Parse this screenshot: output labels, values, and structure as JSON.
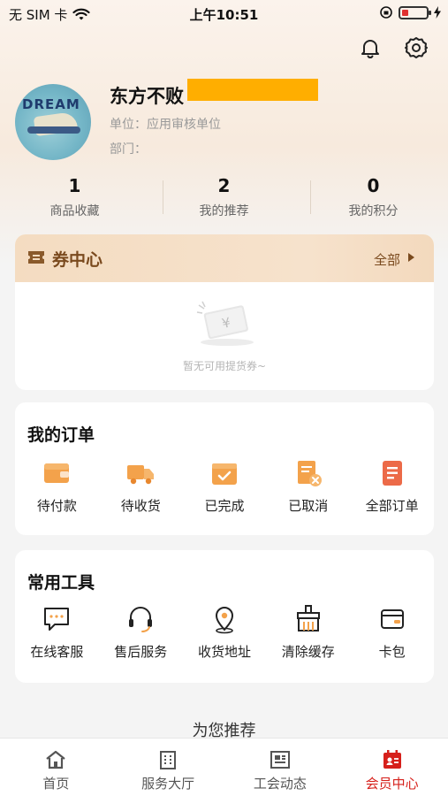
{
  "status_bar": {
    "carrier": "无 SIM 卡",
    "time": "上午10:51"
  },
  "profile": {
    "avatar_text": "DREAM",
    "name": "东方不败",
    "unit": "单位：应用审核单位",
    "dept": "部门："
  },
  "stats": [
    {
      "value": "1",
      "label": "商品收藏"
    },
    {
      "value": "2",
      "label": "我的推荐"
    },
    {
      "value": "0",
      "label": "我的积分"
    }
  ],
  "coupon": {
    "title": "券中心",
    "all": "全部",
    "empty_text": "暂无可用提货券~"
  },
  "orders": {
    "title": "我的订单",
    "items": [
      {
        "label": "待付款",
        "icon": "wallet-icon"
      },
      {
        "label": "待收货",
        "icon": "truck-icon"
      },
      {
        "label": "已完成",
        "icon": "box-check-icon"
      },
      {
        "label": "已取消",
        "icon": "cancel-doc-icon"
      },
      {
        "label": "全部订单",
        "icon": "list-doc-icon"
      }
    ]
  },
  "tools": {
    "title": "常用工具",
    "items": [
      {
        "label": "在线客服",
        "icon": "chat-icon"
      },
      {
        "label": "售后服务",
        "icon": "headset-icon"
      },
      {
        "label": "收货地址",
        "icon": "location-icon"
      },
      {
        "label": "清除缓存",
        "icon": "brush-icon"
      },
      {
        "label": "卡包",
        "icon": "card-wallet-icon"
      }
    ]
  },
  "recommend_title": "为您推荐",
  "tabbar": [
    {
      "label": "首页",
      "icon": "home-icon"
    },
    {
      "label": "服务大厅",
      "icon": "building-icon"
    },
    {
      "label": "工会动态",
      "icon": "news-icon"
    },
    {
      "label": "会员中心",
      "icon": "member-icon",
      "active": true
    }
  ],
  "colors": {
    "accent": "#d6201b",
    "order_icon": "#f0a050",
    "coupon_text": "#7a4a1e"
  }
}
